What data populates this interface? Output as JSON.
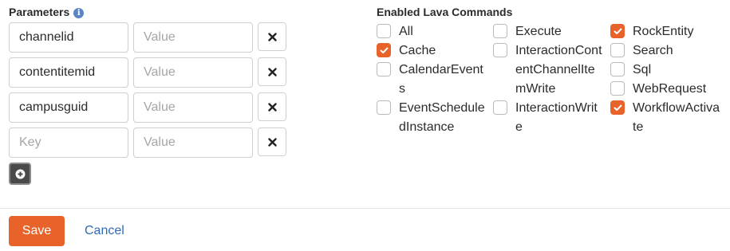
{
  "parameters": {
    "title": "Parameters",
    "info_glyph": "i",
    "rows": [
      {
        "key": "channelid",
        "value": "",
        "value_placeholder": "Value"
      },
      {
        "key": "contentitemid",
        "value": "",
        "value_placeholder": "Value"
      },
      {
        "key": "campusguid",
        "value": "",
        "value_placeholder": "Value"
      },
      {
        "key": "",
        "key_placeholder": "Key",
        "value": "",
        "value_placeholder": "Value"
      }
    ],
    "remove_icon": "x-icon",
    "add_icon": "plus-circle-icon"
  },
  "lava_commands": {
    "title": "Enabled Lava Commands",
    "columns": [
      [
        {
          "label": "All",
          "checked": false
        },
        {
          "label": "Cache",
          "checked": true
        },
        {
          "label": "CalendarEvents",
          "checked": false
        },
        {
          "label": "EventScheduledInstance",
          "checked": false
        }
      ],
      [
        {
          "label": "Execute",
          "checked": false
        },
        {
          "label": "InteractionContentChannelItemWrite",
          "checked": false
        },
        {
          "label": "InteractionWrite",
          "checked": false
        }
      ],
      [
        {
          "label": "RockEntity",
          "checked": true
        },
        {
          "label": "Search",
          "checked": false
        },
        {
          "label": "Sql",
          "checked": false
        },
        {
          "label": "WebRequest",
          "checked": false
        },
        {
          "label": "WorkflowActivate",
          "checked": true
        }
      ]
    ]
  },
  "actions": {
    "save_label": "Save",
    "cancel_label": "Cancel"
  },
  "colors": {
    "accent": "#e7632a",
    "link": "#2f6bb8",
    "info": "#5b84c4",
    "add_button": "#4a4a4a"
  }
}
